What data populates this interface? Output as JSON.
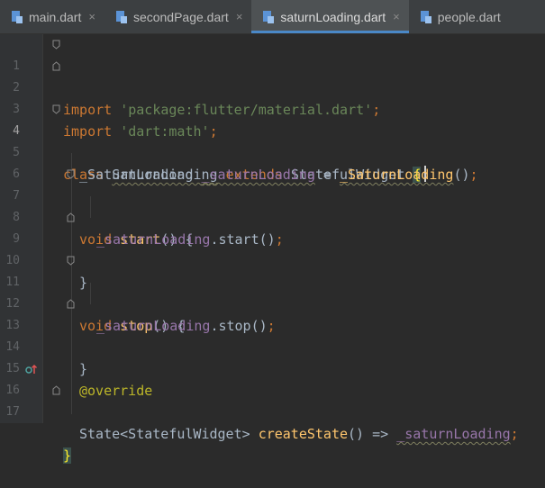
{
  "tabs": [
    {
      "label": "main.dart",
      "active": false
    },
    {
      "label": "secondPage.dart",
      "active": false
    },
    {
      "label": "saturnLoading.dart",
      "active": true
    },
    {
      "label": "people.dart",
      "active": false
    }
  ],
  "close_glyph": "×",
  "lines": {
    "n1": "1",
    "n2": "2",
    "n3": "3",
    "n4": "4",
    "n5": "5",
    "n6": "6",
    "n7": "7",
    "n8": "8",
    "n9": "9",
    "n10": "10",
    "n11": "11",
    "n12": "12",
    "n13": "13",
    "n14": "14",
    "n15": "15",
    "n16": "16",
    "n17": "17"
  },
  "code": {
    "import_kw": "import",
    "import1_str": "'package:flutter/material.dart'",
    "import2_str": "'dart:math'",
    "semi": ";",
    "class_kw": "class",
    "class_name": "SaturnLoading",
    "extends_kw": "extends",
    "super_name": "StatefulWidget",
    "open_brace": "{",
    "close_brace": "}",
    "field_type": "_SaturnLoading",
    "field_name": "_saturnLoading",
    "assign": " = ",
    "ctor_call": "_SaturnLoading",
    "parens": "()",
    "void_kw": "void",
    "start_fn": "start",
    "stop_fn": "stop",
    "fn_sig_tail": "() {",
    "start_call": ".start()",
    "stop_call": ".stop()",
    "override": "@override",
    "state_type": "State<StatefulWidget>",
    "create_fn": "createState",
    "arrow": "() => "
  },
  "colors": {
    "keyword": "#cc7832",
    "string": "#6a8759",
    "function": "#ffc66d",
    "field": "#9876aa",
    "annotation": "#bbb529",
    "text": "#a9b7c6",
    "background": "#2b2b2b",
    "tab_accent": "#4a88c7"
  }
}
